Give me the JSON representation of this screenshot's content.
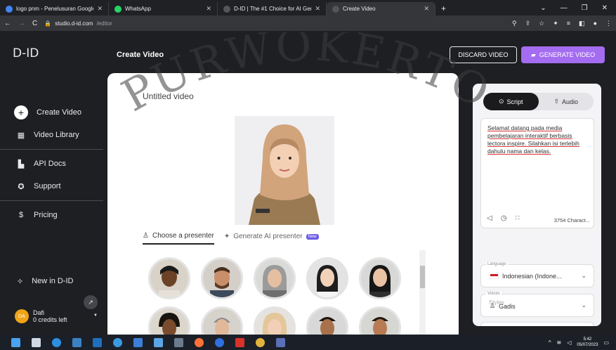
{
  "browser": {
    "tabs": [
      {
        "title": "logo pnm - Penelusuran Google",
        "fav_color": "#4285f4",
        "active": false
      },
      {
        "title": "WhatsApp",
        "fav_color": "#25d366",
        "active": false
      },
      {
        "title": "D-ID | The #1 Choice for AI Gene",
        "fav_color": "#444",
        "active": false
      },
      {
        "title": "Create Video",
        "fav_color": "#444",
        "active": true
      }
    ],
    "url_host": "studio.d-id.com",
    "url_path": "/editor"
  },
  "app": {
    "logo": "D-ID",
    "page_title": "Create Video",
    "discard_label": "DISCARD VIDEO",
    "generate_label": "GENERATE VIDEO"
  },
  "sidebar": {
    "items": [
      {
        "label": "Create Video",
        "icon": "plus-icon"
      },
      {
        "label": "Video Library",
        "icon": "grid-icon"
      },
      {
        "label": "API Docs",
        "icon": "document-icon"
      },
      {
        "label": "Support",
        "icon": "lifebuoy-icon"
      },
      {
        "label": "Pricing",
        "icon": "dollar-icon"
      }
    ],
    "new_in": "New in D-ID",
    "user_initials": "DA",
    "user_name": "Dafi",
    "user_credits": "0 credits left"
  },
  "editor": {
    "video_title": "Untitled video",
    "tab_choose": "Choose a presenter",
    "tab_generate": "Generate AI presenter",
    "badge_new": "New"
  },
  "panel": {
    "tab_script": "Script",
    "tab_audio": "Audio",
    "script_text": "Selamat datang pada media pembelajaran interaktif berbasis lectora inspire. Silahkan isi terlebih dahulu nama dan kelas.",
    "char_count": "3754 Charact...",
    "language_label": "Language",
    "language_value": "Indonesian (Indone...",
    "voices_label": "Voices",
    "voices_value": "Gadis",
    "styles_placeholder": "Styles"
  },
  "watermark": "PURWOKERTO",
  "taskbar": {
    "time": "5:42",
    "date": "05/07/2023"
  }
}
